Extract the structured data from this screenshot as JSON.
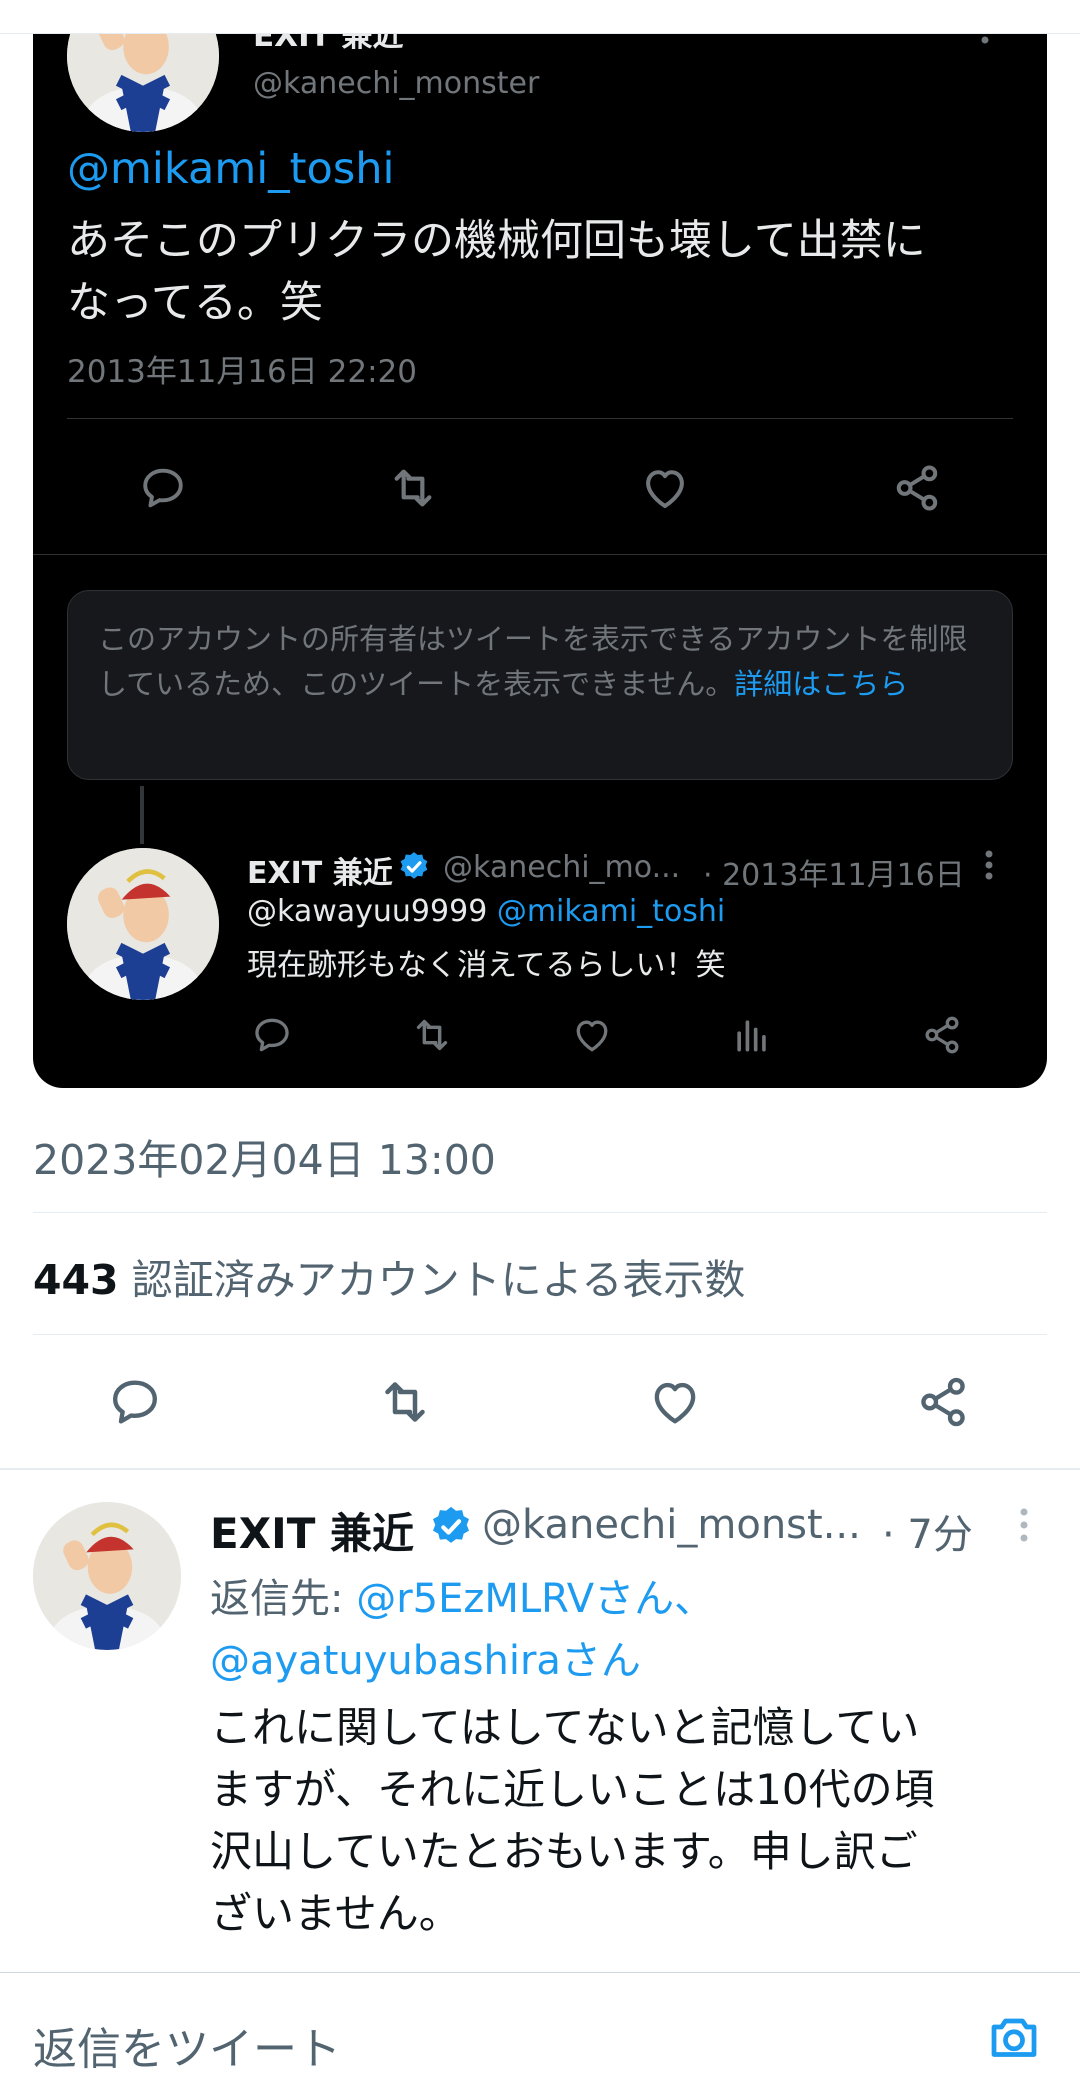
{
  "quote_tweet": {
    "name": "EXIT 兼近",
    "handle": "@kanechi_monster",
    "mention": "@mikami_toshi",
    "text_line1": "あそこのプリクラの機械何回も壊して出禁に",
    "text_line2": "なってる。笑",
    "timestamp": "2013年11月16日 22:20"
  },
  "restricted_notice": {
    "text": "このアカウントの所有者はツイートを表示できるアカウントを制限しているため、このツイートを表示できません。",
    "link": "詳細はこちら"
  },
  "reply_in_card": {
    "name": "EXIT 兼近",
    "handle": "@kanechi_mo...",
    "date": "· 2013年11月16日",
    "mention1": "@kawayuu9999",
    "mention2": "@mikami_toshi",
    "text": "現在跡形もなく消えてるらしい！笑"
  },
  "main_tweet": {
    "timestamp": "2023年02月04日 13:00",
    "view_count": "443",
    "view_label": "認証済みアカウントによる表示数"
  },
  "reply": {
    "name": "EXIT 兼近",
    "handle": "@kanechi_monst...",
    "time": "· 7分",
    "reply_to_label": "返信先: ",
    "reply_to_user1": "@r5EzMLRVさん、",
    "reply_to_user2": "@ayatuyubashiraさん",
    "text_line1": "これに関してはしてないと記憶してい",
    "text_line2": "ますが、それに近しいことは10代の頃",
    "text_line3": "沢山していたとおもいます。申し訳ご",
    "text_line4": "ざいません。"
  },
  "compose": {
    "placeholder": "返信をツイート"
  },
  "colors": {
    "accent": "#1d9bf0",
    "verified": "#1d9bf0",
    "card_bg": "#000000",
    "muted": "#71767b"
  },
  "icons": [
    "reply-icon",
    "retweet-icon",
    "like-icon",
    "share-icon",
    "analytics-icon",
    "verified-icon",
    "more-icon",
    "camera-icon"
  ]
}
